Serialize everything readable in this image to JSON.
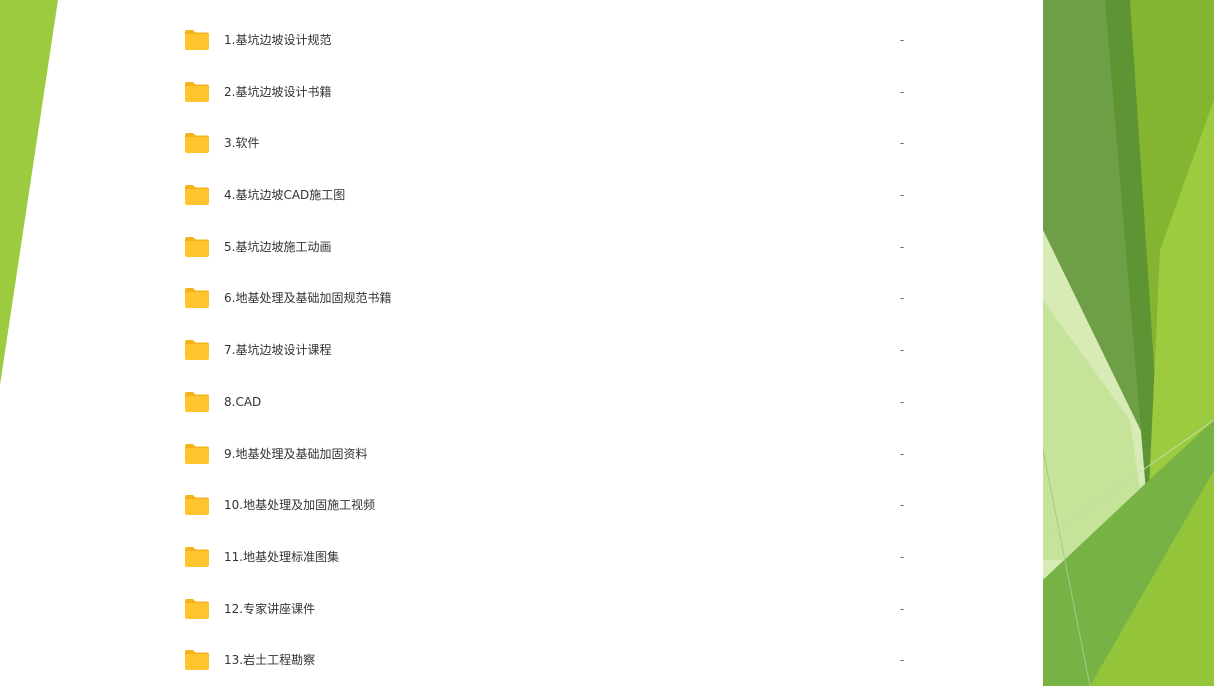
{
  "theme": {
    "folder_color": "#FFC42E",
    "folder_tab_color": "#F5B21A",
    "text_color": "#333333",
    "green_dark": "#5E9433",
    "green_mid": "#7DB33A",
    "green_light": "#9DCB3F",
    "green_pale": "#D8EBB6"
  },
  "file_list": {
    "items": [
      {
        "name": "1.基坑边坡设计规范",
        "size": "-",
        "icon": "folder-icon"
      },
      {
        "name": "2.基坑边坡设计书籍",
        "size": "-",
        "icon": "folder-icon"
      },
      {
        "name": "3.软件",
        "size": "-",
        "icon": "folder-icon"
      },
      {
        "name": "4.基坑边坡CAD施工图",
        "size": "-",
        "icon": "folder-icon"
      },
      {
        "name": "5.基坑边坡施工动画",
        "size": "-",
        "icon": "folder-icon"
      },
      {
        "name": "6.地基处理及基础加固规范书籍",
        "size": "-",
        "icon": "folder-icon"
      },
      {
        "name": "7.基坑边坡设计课程",
        "size": "-",
        "icon": "folder-icon"
      },
      {
        "name": "8.CAD",
        "size": "-",
        "icon": "folder-icon"
      },
      {
        "name": "9.地基处理及基础加固资料",
        "size": "-",
        "icon": "folder-icon"
      },
      {
        "name": "10.地基处理及加固施工视频",
        "size": "-",
        "icon": "folder-icon"
      },
      {
        "name": "11.地基处理标准图集",
        "size": "-",
        "icon": "folder-icon"
      },
      {
        "name": "12.专家讲座课件",
        "size": "-",
        "icon": "folder-icon"
      },
      {
        "name": "13.岩土工程勘察",
        "size": "-",
        "icon": "folder-icon"
      }
    ]
  }
}
